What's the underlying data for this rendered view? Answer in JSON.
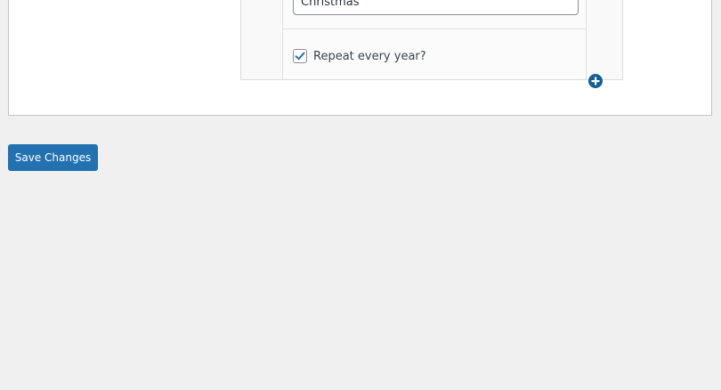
{
  "holiday_row": {
    "name_value": "Christmas",
    "repeat_label": "Repeat every year?",
    "repeat_checked": true
  },
  "icons": {
    "add_row": "plus-circle-icon",
    "checkmark": "check-icon"
  },
  "actions": {
    "save_label": "Save Changes"
  },
  "colors": {
    "accent": "#2271b1",
    "add_icon": "#135e96",
    "checkmark": "#2271b1",
    "page_background": "#f0f0f1"
  }
}
